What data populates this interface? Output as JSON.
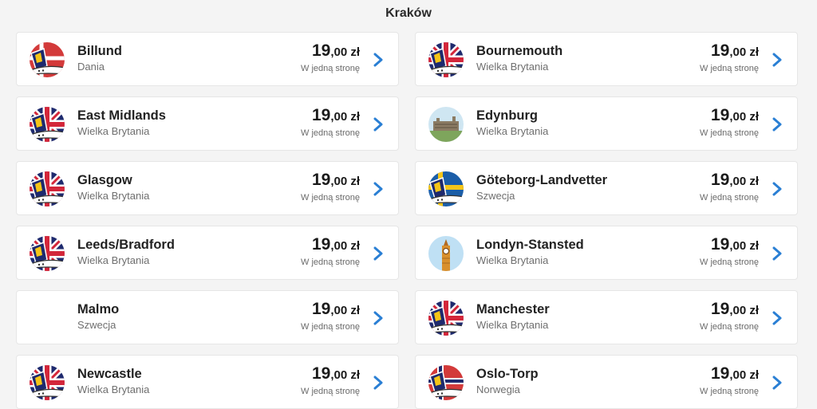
{
  "header": {
    "title": "Kraków"
  },
  "colors": {
    "accent": "#2a7fd4",
    "uk_blue": "#1e2a6e",
    "uk_red": "#d3263a",
    "sweden_yellow": "#f5c518",
    "norway_red": "#d33a3a"
  },
  "destinations": [
    {
      "city": "Billund",
      "country": "Dania",
      "price_main": "19",
      "price_decimals": ",00 zł",
      "note": "W jedną stronę",
      "icon": "denmark-plane-icon"
    },
    {
      "city": "Bournemouth",
      "country": "Wielka Brytania",
      "price_main": "19",
      "price_decimals": ",00 zł",
      "note": "W jedną stronę",
      "icon": "uk-plane-icon"
    },
    {
      "city": "East Midlands",
      "country": "Wielka Brytania",
      "price_main": "19",
      "price_decimals": ",00 zł",
      "note": "W jedną stronę",
      "icon": "uk-plane-icon"
    },
    {
      "city": "Edynburg",
      "country": "Wielka Brytania",
      "price_main": "19",
      "price_decimals": ",00 zł",
      "note": "W jedną stronę",
      "icon": "castle-photo-icon"
    },
    {
      "city": "Glasgow",
      "country": "Wielka Brytania",
      "price_main": "19",
      "price_decimals": ",00 zł",
      "note": "W jedną stronę",
      "icon": "uk-plane-icon"
    },
    {
      "city": "Göteborg-Landvetter",
      "country": "Szwecja",
      "price_main": "19",
      "price_decimals": ",00 zł",
      "note": "W jedną stronę",
      "icon": "sweden-plane-icon"
    },
    {
      "city": "Leeds/Bradford",
      "country": "Wielka Brytania",
      "price_main": "19",
      "price_decimals": ",00 zł",
      "note": "W jedną stronę",
      "icon": "uk-plane-icon"
    },
    {
      "city": "Londyn-Stansted",
      "country": "Wielka Brytania",
      "price_main": "19",
      "price_decimals": ",00 zł",
      "note": "W jedną stronę",
      "icon": "big-ben-icon"
    },
    {
      "city": "Malmo",
      "country": "Szwecja",
      "price_main": "19",
      "price_decimals": ",00 zł",
      "note": "W jedną stronę",
      "icon": ""
    },
    {
      "city": "Manchester",
      "country": "Wielka Brytania",
      "price_main": "19",
      "price_decimals": ",00 zł",
      "note": "W jedną stronę",
      "icon": "uk-plane-icon"
    },
    {
      "city": "Newcastle",
      "country": "Wielka Brytania",
      "price_main": "19",
      "price_decimals": ",00 zł",
      "note": "W jedną stronę",
      "icon": "uk-plane-icon"
    },
    {
      "city": "Oslo-Torp",
      "country": "Norwegia",
      "price_main": "19",
      "price_decimals": ",00 zł",
      "note": "W jedną stronę",
      "icon": "norway-plane-icon"
    }
  ]
}
